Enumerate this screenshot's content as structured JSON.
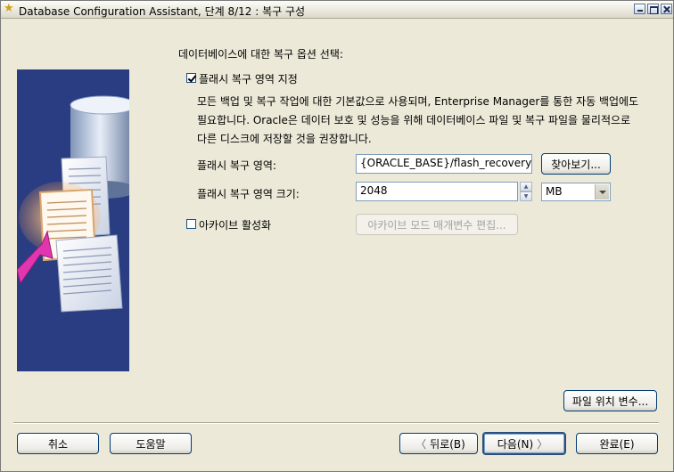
{
  "window": {
    "title": "Database Configuration Assistant, 단계 8/12 : 복구 구성"
  },
  "main": {
    "section_title": "데이터베이스에 대한 복구 옵션 선택:",
    "flash_recovery": {
      "checkbox_label": "플래시 복구 영역 지정",
      "checked": true,
      "description": "모든 백업 및 복구 작업에 대한 기본값으로 사용되며, Enterprise Manager를 통한 자동 백업에도\n필요합니다. Oracle은 데이터 보호 및 성능을 위해 데이터베이스 파일 및 복구 파일을 물리적으로\n다른 디스크에 저장할 것을 권장합니다.",
      "area_label": "플래시 복구 영역:",
      "area_value": "{ORACLE_BASE}/flash_recovery_",
      "browse_label": "찾아보기...",
      "size_label": "플래시 복구 영역 크기:",
      "size_value": "2048",
      "size_unit": "MB"
    },
    "archive": {
      "checkbox_label": "아카이브 활성화",
      "checked": false,
      "edit_params_label": "아카이브 모드 매개변수 편집..."
    },
    "file_location_label": "파일 위치 변수..."
  },
  "footer": {
    "cancel_label": "취소",
    "help_label": "도움말",
    "back_label": "뒤로(B)",
    "next_label": "다음(N)",
    "finish_label": "완료(E)"
  }
}
